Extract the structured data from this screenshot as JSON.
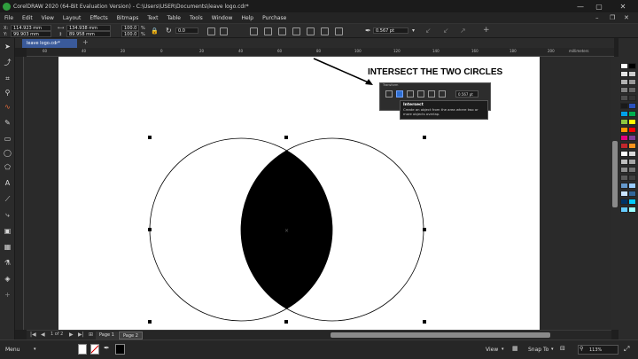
{
  "window": {
    "title": "CorelDRAW 2020 (64-Bit Evaluation Version) - C:\\Users\\USER\\Documents\\leave logo.cdr*"
  },
  "menu": {
    "items": [
      "File",
      "Edit",
      "View",
      "Layout",
      "Effects",
      "Bitmaps",
      "Text",
      "Table",
      "Tools",
      "Window",
      "Help",
      "Purchase"
    ]
  },
  "propbar": {
    "x_label": "X:",
    "x_value": "114.923 mm",
    "y_label": "Y:",
    "y_value": "99.903 mm",
    "w_value": "134.938 mm",
    "h_value": "89.958 mm",
    "scale_w": "100.0",
    "scale_h": "100.0",
    "scale_unit": "%",
    "rotation": "0.0",
    "outline_width": "0.567 pt"
  },
  "doc_tab": {
    "label": "leave logo.cdr*"
  },
  "ruler": {
    "ticks": [
      "60",
      "40",
      "20",
      "0",
      "20",
      "40",
      "60",
      "80",
      "100",
      "120",
      "140",
      "160",
      "180",
      "200",
      "220",
      "240",
      "260",
      "280"
    ],
    "unit": "millimeters"
  },
  "annotation": {
    "text": "INTERSECT THE TWO CIRCLES"
  },
  "mini_window": {
    "title": "Transform",
    "outline_width": "0.567 pt"
  },
  "tooltip": {
    "title": "Intersect",
    "desc": "Create an object from the area where two or more objects overlap."
  },
  "page_tabs": {
    "info": "1 of 2",
    "tabs": [
      "Page 1",
      "Page 2"
    ]
  },
  "status": {
    "menu_label": "Menu",
    "view_label": "View",
    "snap_label": "Snap To",
    "zoom": "113%"
  },
  "palette_colors": [
    "#ffffff",
    "#000000",
    "#e6e6e6",
    "#cccccc",
    "#b3b3b3",
    "#999999",
    "#808080",
    "#666666",
    "#4d4d4d",
    "#333333",
    "#1a1a1a",
    "#2a52be",
    "#00a0e9",
    "#00b050",
    "#8cc63f",
    "#ffff00",
    "#ff9900",
    "#ff0000",
    "#e4007f",
    "#7f3f98",
    "#c1272d",
    "#f7931e",
    "#ffffff",
    "#d9d9d9",
    "#bfbfbf",
    "#a6a6a6",
    "#8c8c8c",
    "#737373",
    "#595959",
    "#404040",
    "#6699cc",
    "#99ccff",
    "#cce5ff",
    "#336699",
    "#003366",
    "#00ccff",
    "#66ccff",
    "#99ffff"
  ],
  "colors": {
    "tab_active": "#3a5a9a",
    "ui_dark": "#2b2b2b"
  }
}
